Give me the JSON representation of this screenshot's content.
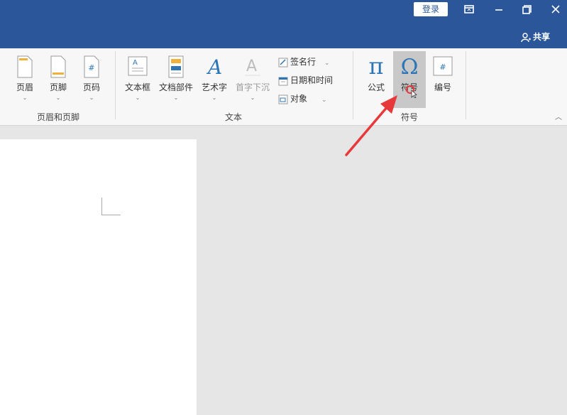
{
  "titlebar": {
    "login_label": "登录",
    "share_label": "共享"
  },
  "ribbon": {
    "header_footer_group": {
      "label": "页眉和页脚",
      "buttons": [
        "页眉",
        "页脚",
        "页码"
      ]
    },
    "text_group": {
      "label": "文本",
      "buttons": [
        "文本框",
        "文档部件",
        "艺术字",
        "首字下沉"
      ],
      "small_buttons": [
        "签名行",
        "日期和时间",
        "对象"
      ]
    },
    "symbols_group": {
      "label": "符号",
      "buttons": [
        "公式",
        "符号",
        "编号"
      ]
    }
  },
  "colors": {
    "titlebar": "#2b579a",
    "accent_blue": "#2e75b6",
    "arrow_red": "#e8393a"
  }
}
